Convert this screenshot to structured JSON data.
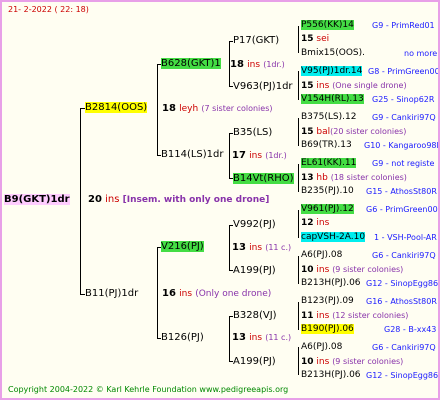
{
  "header": {
    "date": "21-  2-2022  ( 22:  18)"
  },
  "root": {
    "name": "B9(GKT)1dr",
    "num": "20",
    "unit": "ins",
    "note": "[Insem. with only one drone]"
  },
  "gen1": {
    "top": {
      "name": "B2814(OOS)",
      "num": "18",
      "unit": "leyh",
      "note": "(7 sister colonies)"
    },
    "bottom": {
      "name": "B11(PJ)1dr",
      "num": "16",
      "unit": "ins",
      "note": "(Only one drone)"
    }
  },
  "gen2": {
    "a": {
      "name": "B628(GKT)1",
      "num": "18",
      "unit": "ins",
      "note": "(1dr.)"
    },
    "b": {
      "name": "B114(LS)1dr",
      "num": "17",
      "unit": "ins",
      "note": "(1dr.)"
    },
    "c": {
      "name": "V216(PJ)",
      "num": "13",
      "unit": "ins",
      "note": "(11 c.)"
    },
    "d": {
      "name": "B126(PJ)",
      "num": "13",
      "unit": "ins",
      "note": "(11 c.)"
    }
  },
  "gen3": {
    "a1": {
      "name": "P17(GKT)"
    },
    "a2": {
      "name": "V963(PJ)1dr"
    },
    "b1": {
      "name": "B35(LS)"
    },
    "b2": {
      "name": "B14Vt(RHO)"
    },
    "c1": {
      "name": "V992(PJ)"
    },
    "c2": {
      "name": "A199(PJ)"
    },
    "d1": {
      "name": "B328(VJ)"
    },
    "d2": {
      "name": "A199(PJ)"
    }
  },
  "right": [
    {
      "top": "P556(KK)14",
      "topInfo": "G9 - PrimRed01",
      "mid": "15",
      "midUnit": "sei",
      "midNote": "",
      "bot": "Bmix15(OOS).",
      "botInfo": "no more"
    },
    {
      "top": "V95(PJ)1dr.14",
      "topInfo": "G8 - PrimGreen00",
      "mid": "15",
      "midUnit": "ins",
      "midNote": "(One single drone)",
      "bot": "V154H(RL).13",
      "botInfo": "G25 - Sinop62R"
    },
    {
      "top": "B375(LS).12",
      "topInfo": "G9 - Cankiri97Q",
      "mid": "15",
      "midUnit": "bal",
      "midNote": "(20 sister colonies)",
      "bot": "B69(TR).13",
      "botInfo": "G10 - Kangaroo98R"
    },
    {
      "top": "EL61(KK).11",
      "topInfo": "G9 - not registe",
      "mid": "13",
      "midUnit": "hb",
      "midNote": "(18 sister colonies)",
      "bot": "B235(PJ).10",
      "botInfo": "G15 - AthosSt80R"
    },
    {
      "top": "V961(PJ).12",
      "topInfo": "G6 - PrimGreen00",
      "mid": "12",
      "midUnit": "ins",
      "midNote": "",
      "bot": "capVSH-2A.10",
      "botInfo": "1 - VSH-Pool-AR"
    },
    {
      "top": "A6(PJ).08",
      "topInfo": "G6 - Cankiri97Q",
      "mid": "10",
      "midUnit": "ins",
      "midNote": "(9 sister colonies)",
      "bot": "B213H(PJ).06",
      "botInfo": "G12 - SinopEgg86R"
    },
    {
      "top": "B123(PJ).09",
      "topInfo": "G16 - AthosSt80R",
      "mid": "11",
      "midUnit": "ins",
      "midNote": "(12 sister colonies)",
      "bot": "B190(PJ).06",
      "botInfo": "G28 - B-xx43"
    },
    {
      "top": "A6(PJ).08",
      "topInfo": "G6 - Cankiri97Q",
      "mid": "10",
      "midUnit": "ins",
      "midNote": "(9 sister colonies)",
      "bot": "B213H(PJ).06",
      "botInfo": "G12 - SinopEgg86R"
    }
  ],
  "footer": {
    "copyright": "Copyright 2004-2022 © Karl Kehrle Foundation   www.pedigreeapis.org"
  }
}
